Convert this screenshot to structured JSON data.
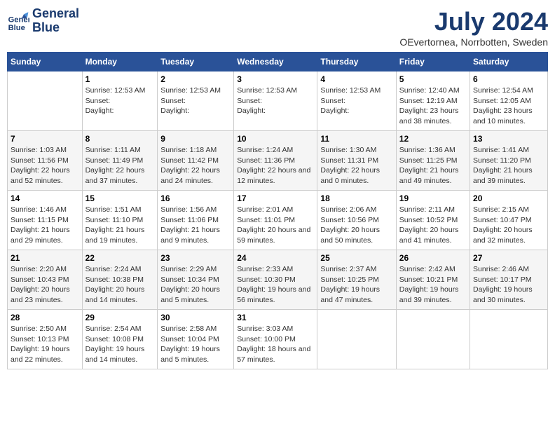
{
  "header": {
    "logo_line1": "General",
    "logo_line2": "Blue",
    "title": "July 2024",
    "subtitle": "OEvertornea, Norrbotten, Sweden"
  },
  "days_of_week": [
    "Sunday",
    "Monday",
    "Tuesday",
    "Wednesday",
    "Thursday",
    "Friday",
    "Saturday"
  ],
  "weeks": [
    [
      {
        "num": "",
        "info": ""
      },
      {
        "num": "1",
        "info": "Sunrise: 12:53 AM\nSunset: \nDaylight: "
      },
      {
        "num": "2",
        "info": "Sunrise: 12:53 AM\nSunset: \nDaylight: "
      },
      {
        "num": "3",
        "info": "Sunrise: 12:53 AM\nSunset: \nDaylight: "
      },
      {
        "num": "4",
        "info": "Sunrise: 12:53 AM\nSunset: \nDaylight: "
      },
      {
        "num": "5",
        "info": "Sunrise: 12:40 AM\nSunset: 12:19 AM\nDaylight: 23 hours and 38 minutes."
      },
      {
        "num": "6",
        "info": "Sunrise: 12:54 AM\nSunset: 12:05 AM\nDaylight: 23 hours and 10 minutes."
      }
    ],
    [
      {
        "num": "7",
        "info": "Sunrise: 1:03 AM\nSunset: 11:56 PM\nDaylight: 22 hours and 52 minutes."
      },
      {
        "num": "8",
        "info": "Sunrise: 1:11 AM\nSunset: 11:49 PM\nDaylight: 22 hours and 37 minutes."
      },
      {
        "num": "9",
        "info": "Sunrise: 1:18 AM\nSunset: 11:42 PM\nDaylight: 22 hours and 24 minutes."
      },
      {
        "num": "10",
        "info": "Sunrise: 1:24 AM\nSunset: 11:36 PM\nDaylight: 22 hours and 12 minutes."
      },
      {
        "num": "11",
        "info": "Sunrise: 1:30 AM\nSunset: 11:31 PM\nDaylight: 22 hours and 0 minutes."
      },
      {
        "num": "12",
        "info": "Sunrise: 1:36 AM\nSunset: 11:25 PM\nDaylight: 21 hours and 49 minutes."
      },
      {
        "num": "13",
        "info": "Sunrise: 1:41 AM\nSunset: 11:20 PM\nDaylight: 21 hours and 39 minutes."
      }
    ],
    [
      {
        "num": "14",
        "info": "Sunrise: 1:46 AM\nSunset: 11:15 PM\nDaylight: 21 hours and 29 minutes."
      },
      {
        "num": "15",
        "info": "Sunrise: 1:51 AM\nSunset: 11:10 PM\nDaylight: 21 hours and 19 minutes."
      },
      {
        "num": "16",
        "info": "Sunrise: 1:56 AM\nSunset: 11:06 PM\nDaylight: 21 hours and 9 minutes."
      },
      {
        "num": "17",
        "info": "Sunrise: 2:01 AM\nSunset: 11:01 PM\nDaylight: 20 hours and 59 minutes."
      },
      {
        "num": "18",
        "info": "Sunrise: 2:06 AM\nSunset: 10:56 PM\nDaylight: 20 hours and 50 minutes."
      },
      {
        "num": "19",
        "info": "Sunrise: 2:11 AM\nSunset: 10:52 PM\nDaylight: 20 hours and 41 minutes."
      },
      {
        "num": "20",
        "info": "Sunrise: 2:15 AM\nSunset: 10:47 PM\nDaylight: 20 hours and 32 minutes."
      }
    ],
    [
      {
        "num": "21",
        "info": "Sunrise: 2:20 AM\nSunset: 10:43 PM\nDaylight: 20 hours and 23 minutes."
      },
      {
        "num": "22",
        "info": "Sunrise: 2:24 AM\nSunset: 10:38 PM\nDaylight: 20 hours and 14 minutes."
      },
      {
        "num": "23",
        "info": "Sunrise: 2:29 AM\nSunset: 10:34 PM\nDaylight: 20 hours and 5 minutes."
      },
      {
        "num": "24",
        "info": "Sunrise: 2:33 AM\nSunset: 10:30 PM\nDaylight: 19 hours and 56 minutes."
      },
      {
        "num": "25",
        "info": "Sunrise: 2:37 AM\nSunset: 10:25 PM\nDaylight: 19 hours and 47 minutes."
      },
      {
        "num": "26",
        "info": "Sunrise: 2:42 AM\nSunset: 10:21 PM\nDaylight: 19 hours and 39 minutes."
      },
      {
        "num": "27",
        "info": "Sunrise: 2:46 AM\nSunset: 10:17 PM\nDaylight: 19 hours and 30 minutes."
      }
    ],
    [
      {
        "num": "28",
        "info": "Sunrise: 2:50 AM\nSunset: 10:13 PM\nDaylight: 19 hours and 22 minutes."
      },
      {
        "num": "29",
        "info": "Sunrise: 2:54 AM\nSunset: 10:08 PM\nDaylight: 19 hours and 14 minutes."
      },
      {
        "num": "30",
        "info": "Sunrise: 2:58 AM\nSunset: 10:04 PM\nDaylight: 19 hours and 5 minutes."
      },
      {
        "num": "31",
        "info": "Sunrise: 3:03 AM\nSunset: 10:00 PM\nDaylight: 18 hours and 57 minutes."
      },
      {
        "num": "",
        "info": ""
      },
      {
        "num": "",
        "info": ""
      },
      {
        "num": "",
        "info": ""
      }
    ]
  ]
}
